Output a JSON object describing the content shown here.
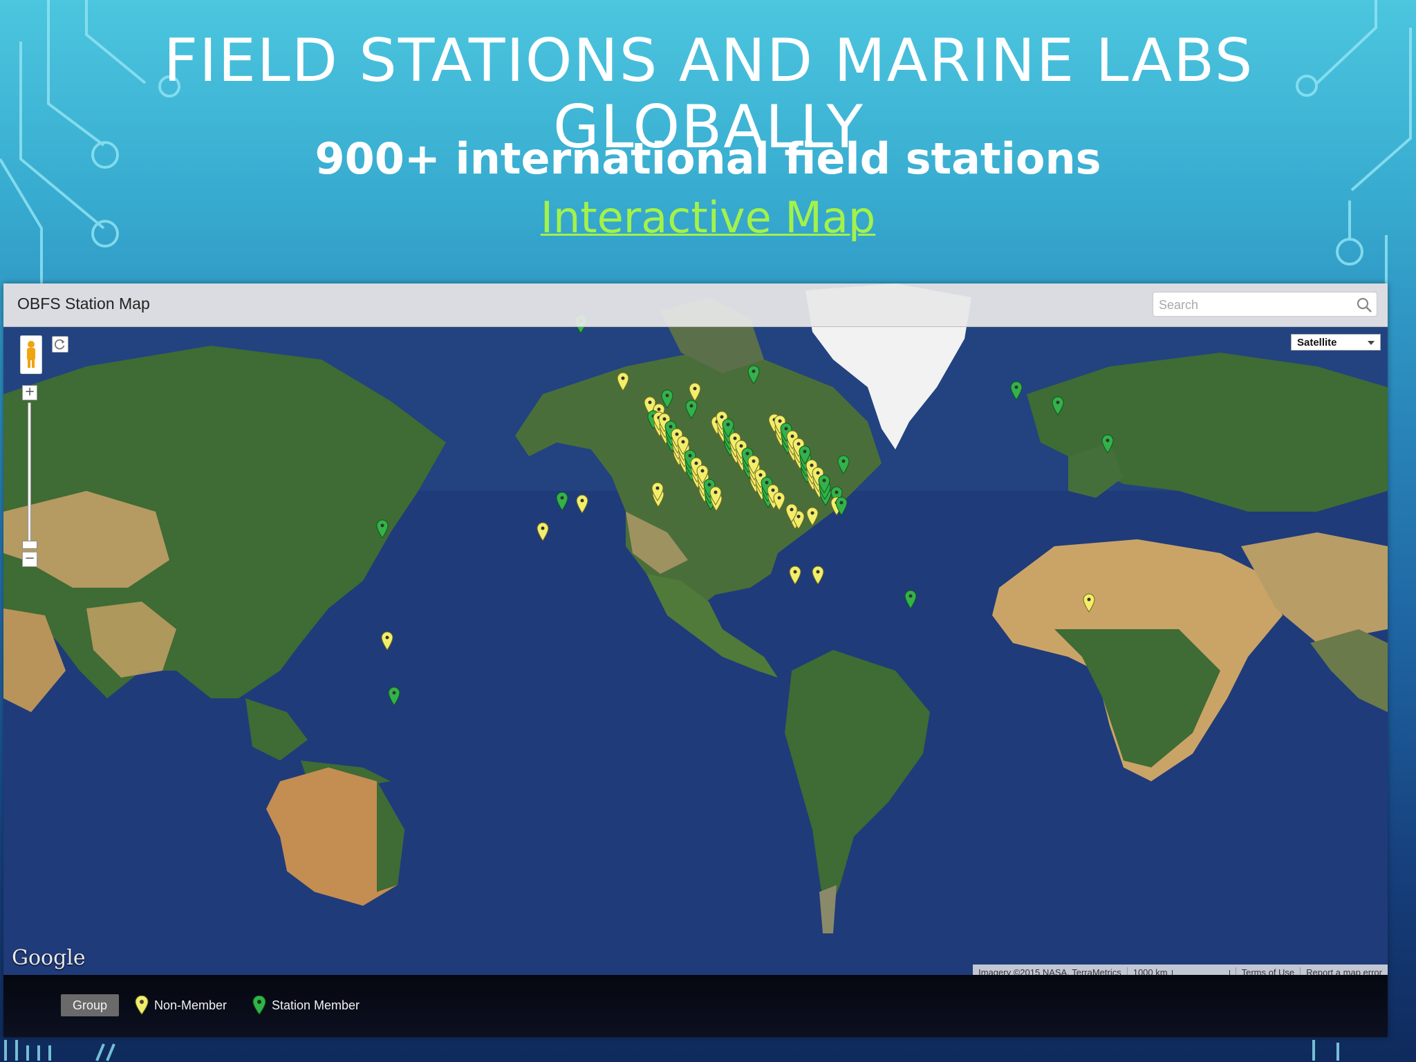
{
  "slide": {
    "title": "FIELD STATIONS AND MARINE LABS GLOBALLY",
    "subtitle": "900+ international field stations",
    "link_text": "Interactive Map"
  },
  "map": {
    "header_title": "OBFS Station Map",
    "search_placeholder": "Search",
    "map_type": "Satellite",
    "zoom_in_label": "+",
    "zoom_out_label": "−",
    "google_logo": "Google",
    "attribution": {
      "imagery": "Imagery ©2015 NASA, TerraMetrics",
      "scale": "1000 km",
      "terms": "Terms of Use",
      "report": "Report a map error"
    },
    "footer": {
      "group_button": "Group",
      "legend_nonmember": "Non-Member",
      "legend_member": "Station Member"
    },
    "colors": {
      "ocean": "#1f3b7a",
      "land": "#3f6b34",
      "desert": "#caa467",
      "ice": "#f2f2f2",
      "nonmember_pin": "#f3ee6a",
      "member_pin": "#33b24a",
      "link": "#a3f24a"
    }
  }
}
